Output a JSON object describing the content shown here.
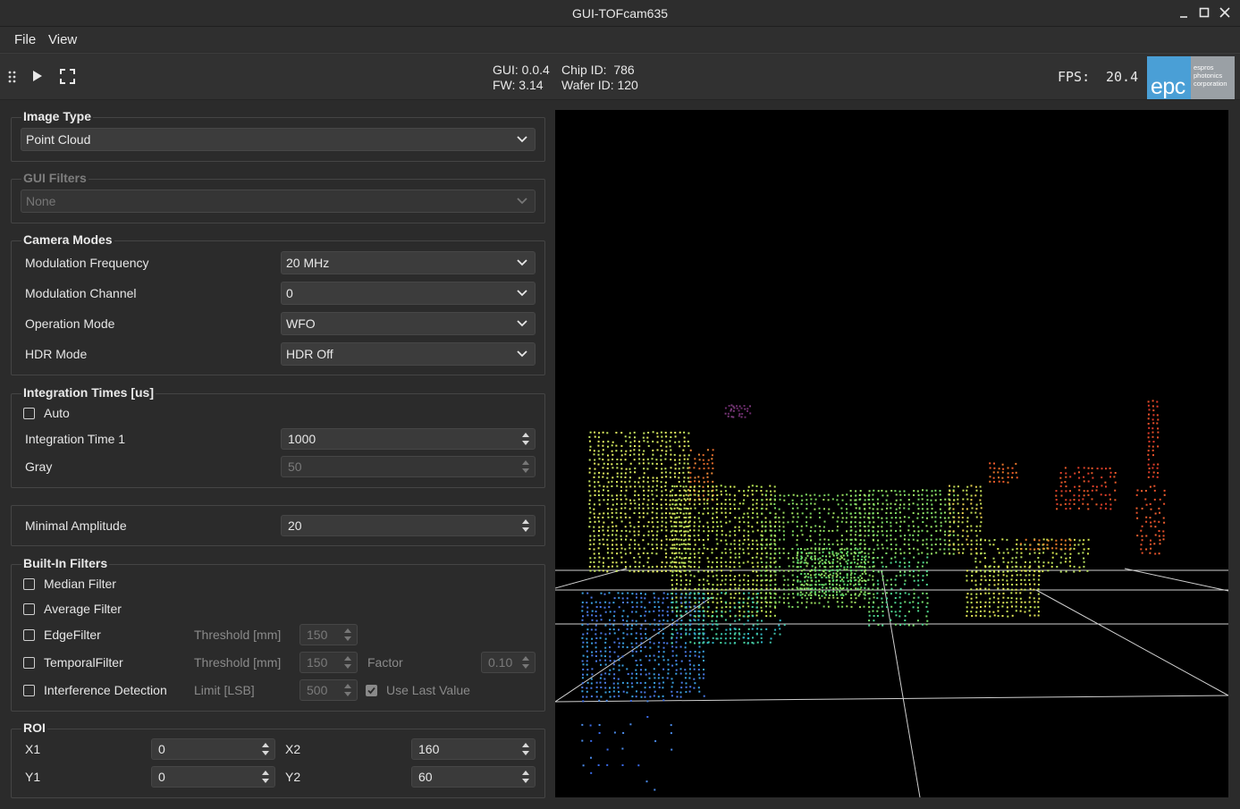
{
  "window": {
    "title": "GUI-TOFcam635"
  },
  "menu": {
    "file": "File",
    "view": "View"
  },
  "toolbar": {
    "gui_version": "GUI: 0.0.4",
    "fw_version": "FW: 3.14",
    "chip_id": "Chip ID:  786",
    "wafer_id": "Wafer ID: 120",
    "fps_label": "FPS:",
    "fps_value": "20.4",
    "logo_text": "epc",
    "logo_company": [
      "espros",
      "photonics",
      "corporation"
    ]
  },
  "image_type": {
    "title": "Image Type",
    "value": "Point Cloud"
  },
  "gui_filters": {
    "title": "GUI Filters",
    "value": "None"
  },
  "camera_modes": {
    "title": "Camera Modes",
    "rows": [
      {
        "label": "Modulation Frequency",
        "value": "20 MHz"
      },
      {
        "label": "Modulation Channel",
        "value": "0"
      },
      {
        "label": "Operation Mode",
        "value": "WFO"
      },
      {
        "label": "HDR Mode",
        "value": "HDR Off"
      }
    ]
  },
  "integration": {
    "title": "Integration Times [us]",
    "auto_label": "Auto",
    "time1_label": "Integration Time 1",
    "time1_value": "1000",
    "gray_label": "Gray",
    "gray_value": "50"
  },
  "amplitude": {
    "label": "Minimal Amplitude",
    "value": "20"
  },
  "filters": {
    "title": "Built-In Filters",
    "median": "Median Filter",
    "average": "Average Filter",
    "edge": "EdgeFilter",
    "edge_threshold_label": "Threshold [mm]",
    "edge_threshold_value": "150",
    "temporal": "TemporalFilter",
    "temporal_threshold_label": "Threshold [mm]",
    "temporal_threshold_value": "150",
    "factor_label": "Factor",
    "factor_value": "0.10",
    "interference": "Interference Detection",
    "limit_label": "Limit [LSB]",
    "limit_value": "500",
    "use_last_label": "Use Last Value"
  },
  "roi": {
    "title": "ROI",
    "x1_label": "X1",
    "x1_value": "0",
    "x2_label": "X2",
    "x2_value": "160",
    "y1_label": "Y1",
    "y1_value": "0",
    "y2_label": "Y2",
    "y2_value": "60"
  },
  "colors": {
    "background": "#2b2b2b",
    "view_bg": "#000000",
    "logo_blue": "#4a9fd6",
    "logo_gray": "#9aa0a5"
  }
}
